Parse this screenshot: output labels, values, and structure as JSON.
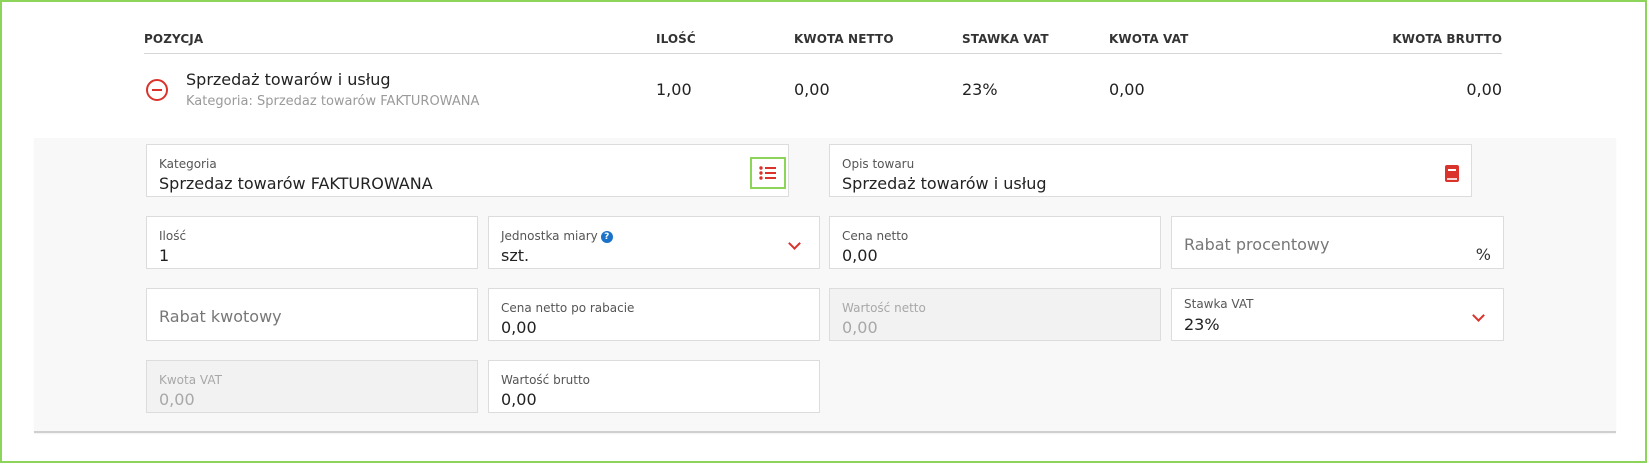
{
  "table": {
    "headers": {
      "pozycja": "POZYCJA",
      "ilosc": "ILOŚĆ",
      "kwota_netto": "KWOTA NETTO",
      "stawka_vat": "STAWKA VAT",
      "kwota_vat": "KWOTA VAT",
      "kwota_brutto": "KWOTA BRUTTO"
    },
    "row": {
      "name": "Sprzedaż towarów i usług",
      "category": "Kategoria: Sprzedaz towarów FAKTUROWANA",
      "ilosc": "1,00",
      "kwota_netto": "0,00",
      "stawka_vat": "23%",
      "kwota_vat": "0,00",
      "kwota_brutto": "0,00"
    }
  },
  "form": {
    "kategoria": {
      "label": "Kategoria",
      "value": "Sprzedaz towarów FAKTUROWANA"
    },
    "opis": {
      "label": "Opis towaru",
      "value": "Sprzedaż towarów i usług"
    },
    "ilosc": {
      "label": "Ilość",
      "value": "1"
    },
    "jednostka": {
      "label": "Jednostka miary",
      "value": "szt.",
      "help": "?"
    },
    "cena_netto": {
      "label": "Cena netto",
      "value": "0,00"
    },
    "rabat_procentowy": {
      "placeholder": "Rabat procentowy",
      "suffix": "%"
    },
    "rabat_kwotowy": {
      "placeholder": "Rabat kwotowy"
    },
    "cena_po_rabacie": {
      "label": "Cena netto po rabacie",
      "value": "0,00"
    },
    "wartosc_netto": {
      "label": "Wartość netto",
      "value": "0,00"
    },
    "stawka_vat": {
      "label": "Stawka VAT",
      "value": "23%"
    },
    "kwota_vat": {
      "label": "Kwota VAT",
      "value": "0,00"
    },
    "wartosc_brutto": {
      "label": "Wartość brutto",
      "value": "0,00"
    }
  },
  "icons": {
    "remove": "minus-circle-icon",
    "list": "list-icon",
    "book": "book-icon",
    "chevron": "chevron-down-icon",
    "help": "help-icon"
  },
  "colors": {
    "accent_red": "#d9332c",
    "highlight_green": "#8cd45a",
    "help_blue": "#1a73c9"
  }
}
